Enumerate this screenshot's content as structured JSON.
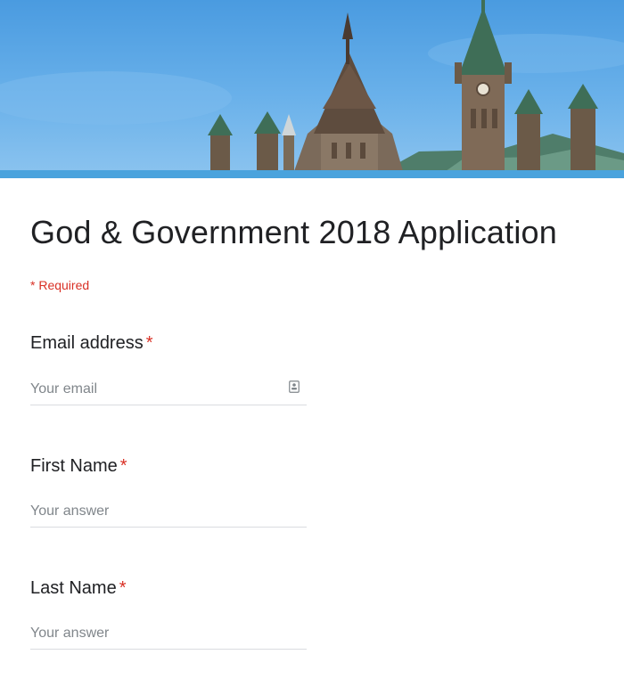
{
  "form": {
    "title": "God & Government 2018 Application",
    "required_note": "* Required",
    "required_marker": "*"
  },
  "questions": [
    {
      "label": "Email address",
      "placeholder": "Your email",
      "value": "",
      "icon": "contact-card-icon"
    },
    {
      "label": "First Name",
      "placeholder": "Your answer",
      "value": ""
    },
    {
      "label": "Last Name",
      "placeholder": "Your answer",
      "value": ""
    }
  ],
  "colors": {
    "required": "#d93025",
    "title": "#202124",
    "placeholder": "#80868b",
    "underline": "#dadce0",
    "sky": "#5aa8e6",
    "banner_strip": "#4aa3dd"
  }
}
